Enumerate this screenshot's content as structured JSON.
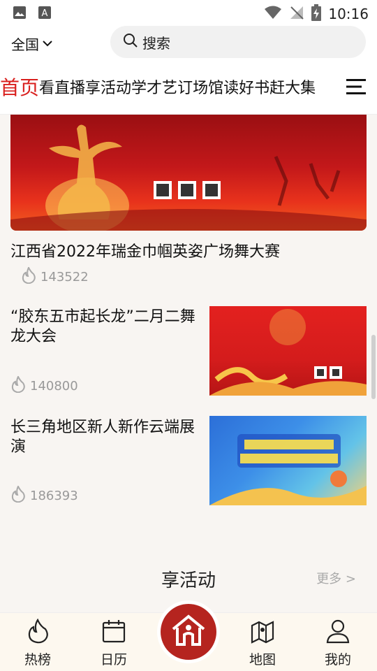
{
  "status_bar": {
    "time": "10:16",
    "icons": [
      "image-icon",
      "a-badge-icon",
      "wifi-icon",
      "no-signal-icon",
      "battery-charging-icon"
    ]
  },
  "header": {
    "region": "全国",
    "search_placeholder": "搜索"
  },
  "nav": {
    "tabs": [
      "首页",
      "看直播",
      "享活动",
      "学才艺",
      "订场馆",
      "读好书",
      "赶大集"
    ],
    "active_index": 0
  },
  "feed": {
    "hero": {
      "title": "江西省2022年瑞金巾帼英姿广场舞大赛",
      "views": "143522"
    },
    "cards": [
      {
        "title": "“胶东五市起长龙”二月二舞龙大会",
        "views": "140800"
      },
      {
        "title": "长三角地区新人新作云端展演",
        "views": "186393"
      }
    ]
  },
  "section": {
    "title": "享活动",
    "more": "更多 >"
  },
  "tabbar": {
    "items": [
      {
        "label": "热榜",
        "icon": "flame-icon"
      },
      {
        "label": "日历",
        "icon": "calendar-icon"
      },
      {
        "label": "",
        "icon": "home-icon"
      },
      {
        "label": "地图",
        "icon": "map-icon"
      },
      {
        "label": "我的",
        "icon": "user-icon"
      }
    ]
  },
  "colors": {
    "accent": "#d9201e",
    "home_button": "#b5241f",
    "muted": "#999999"
  }
}
